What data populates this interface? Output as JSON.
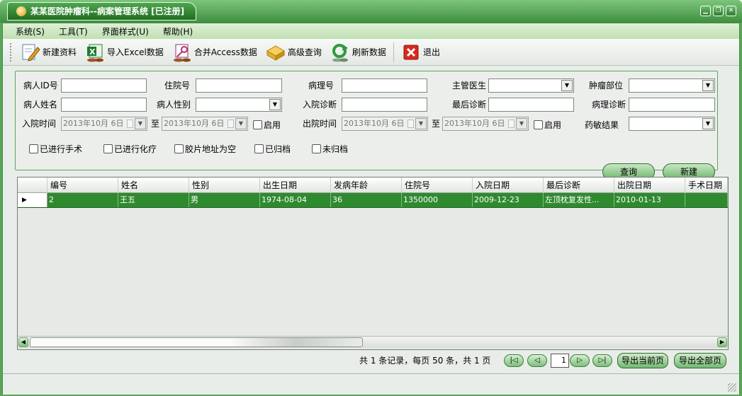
{
  "window": {
    "title": "某某医院肿瘤科--病案管理系统 [已注册]",
    "accent_color": "#3f8f3f",
    "controls": [
      "minimize-icon",
      "restore-icon",
      "close-icon"
    ]
  },
  "menu": [
    "系统(S)",
    "工具(T)",
    "界面样式(U)",
    "帮助(H)"
  ],
  "toolbar": {
    "new_record": {
      "label": "新建资料",
      "icon": "edit-document-icon"
    },
    "import_excel": {
      "label": "导入Excel数据",
      "icon": "excel-icon"
    },
    "merge_access": {
      "label": "合并Access数据",
      "icon": "access-key-icon"
    },
    "advanced_query": {
      "label": "高级查询",
      "icon": "folder-search-icon"
    },
    "refresh": {
      "label": "刷新数据",
      "icon": "refresh-icon"
    },
    "exit": {
      "label": "退出",
      "icon": "exit-x-icon"
    }
  },
  "filters": {
    "patient_id": {
      "label": "病人ID号",
      "value": ""
    },
    "hospital_no": {
      "label": "住院号",
      "value": ""
    },
    "pathology_no": {
      "label": "病理号",
      "value": ""
    },
    "doctor": {
      "label": "主管医生",
      "value": ""
    },
    "tumor_site": {
      "label": "肿瘤部位",
      "value": ""
    },
    "patient_name": {
      "label": "病人姓名",
      "value": ""
    },
    "patient_gender": {
      "label": "病人性别",
      "value": ""
    },
    "admission_diagnosis": {
      "label": "入院诊断",
      "value": ""
    },
    "final_diagnosis": {
      "label": "最后诊断",
      "value": ""
    },
    "pathology_diagnosis": {
      "label": "病理诊断",
      "value": ""
    },
    "admission_time": {
      "label": "入院时间",
      "from": "2013年10月  6日",
      "to_label": "至",
      "to": "2013年10月  6日",
      "enable_label": "启用"
    },
    "discharge_time": {
      "label": "出院时间",
      "from": "2013年10月  6日",
      "to_label": "至",
      "to": "2013年10月  6日",
      "enable_label": "启用"
    },
    "drug_sensitivity": {
      "label": "药敏结果",
      "value": ""
    },
    "checks": {
      "surgery": "已进行手术",
      "chemo": "已进行化疗",
      "film_empty": "胶片地址为空",
      "archived": "已归档",
      "unarchived": "未归档"
    },
    "query_label": "查询",
    "new_label": "新建"
  },
  "table": {
    "columns": [
      "编号",
      "姓名",
      "性别",
      "出生日期",
      "发病年龄",
      "住院号",
      "入院日期",
      "最后诊断",
      "出院日期",
      "手术日期"
    ],
    "rows": [
      [
        "2",
        "王五",
        "男",
        "1974-08-04",
        "36",
        "1350000",
        "2009-12-23",
        "左顶枕复发性...",
        "2010-01-13",
        ""
      ]
    ],
    "selected_row_color": "#2f8a2f"
  },
  "pager": {
    "summary": "共 1 条记录，每页 50 条，共 1 页",
    "current_page": "1",
    "first": "|◁",
    "prev": "◁",
    "next": "▷",
    "last": "▷|",
    "export_current": "导出当前页",
    "export_all": "导出全部页"
  }
}
